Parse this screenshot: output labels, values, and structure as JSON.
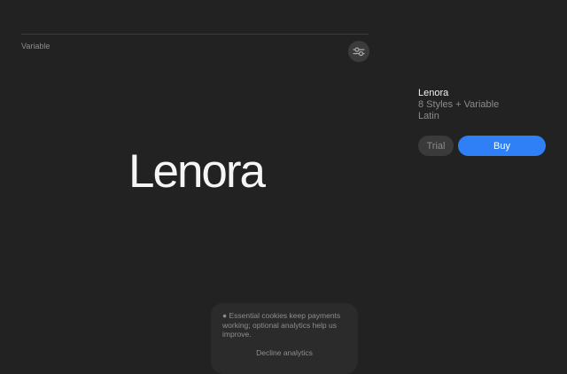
{
  "specimen": {
    "style_label": "Variable",
    "sample_text": "Lenora",
    "settings_icon": "sliders-icon"
  },
  "product": {
    "name": "Lenora",
    "styles": "8 Styles + Variable",
    "script": "Latin",
    "trial_label": "Trial",
    "buy_label": "Buy"
  },
  "cookie_banner": {
    "message": "● Essential cookies keep payments working; optional analytics help us improve.",
    "decline_label": "Decline analytics"
  },
  "colors": {
    "background": "#222222",
    "accent": "#2f80f6",
    "muted_text": "#8c8c8c"
  }
}
